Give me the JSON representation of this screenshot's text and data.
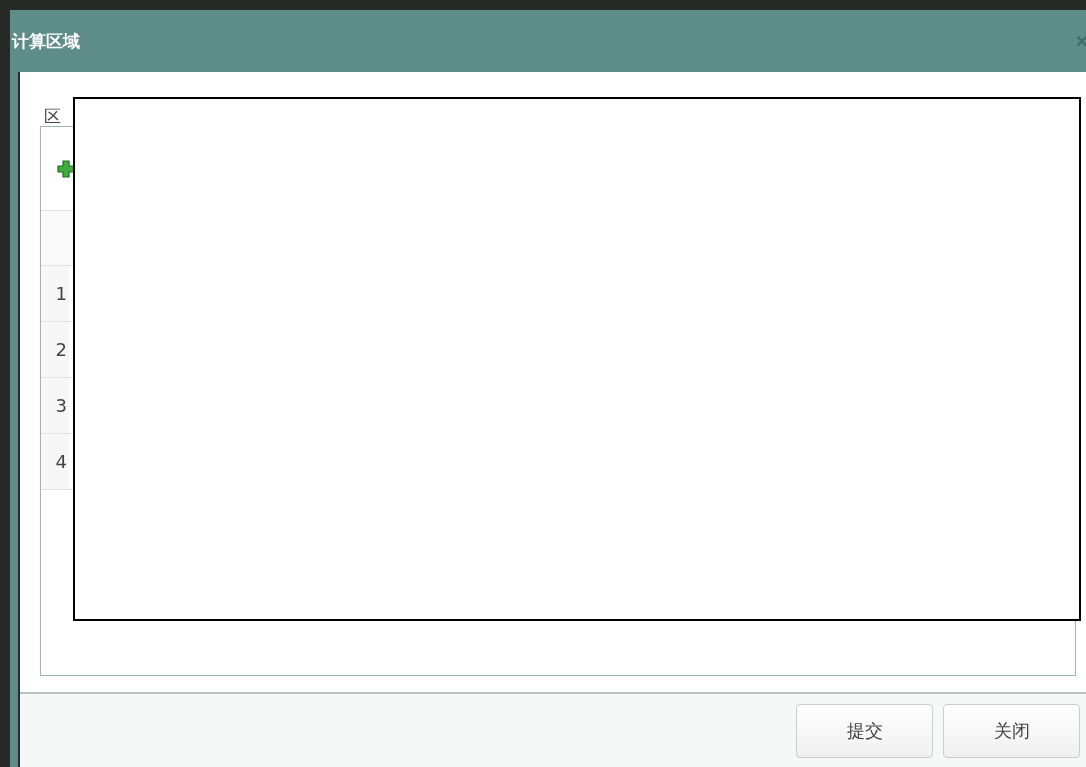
{
  "window": {
    "title": "计算区域",
    "close": "×"
  },
  "field_label": "区",
  "table": {
    "rows": [
      {
        "number": "1"
      },
      {
        "number": "2"
      },
      {
        "number": "3"
      },
      {
        "number": "4"
      }
    ]
  },
  "buttons": [
    "提交",
    "关闭"
  ]
}
